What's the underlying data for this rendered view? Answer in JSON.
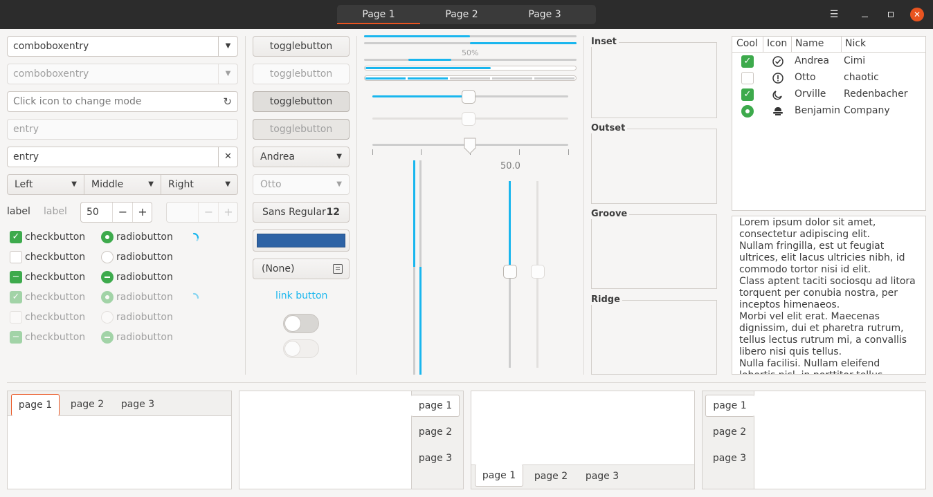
{
  "header": {
    "tabs": [
      "Page 1",
      "Page 2",
      "Page 3"
    ],
    "menu_icon": "hamburger-icon",
    "minimize_icon": "minimize-icon",
    "maximize_icon": "maximize-icon",
    "close_icon": "close-icon"
  },
  "col1": {
    "combo1": "comboboxentry",
    "combo2": "comboboxentry",
    "mode_placeholder": "Click icon to change mode",
    "entry_placeholder": "entry",
    "entry_value": "entry",
    "left": "Left",
    "middle": "Middle",
    "right": "Right",
    "label1": "label",
    "label2": "label",
    "spin_value": "50",
    "minus": "−",
    "plus": "+",
    "check_label": "checkbutton",
    "radio_label": "radiobutton"
  },
  "col2": {
    "toggle": "togglebutton",
    "combo_andrea": "Andrea",
    "combo_otto": "Otto",
    "font_name": "Sans Regular",
    "font_size": "12",
    "color_value": "#2e63a5",
    "file_none": "(None)",
    "link": "link button"
  },
  "col3": {
    "progress_text": "50%",
    "scale_value": "50.0",
    "progress_value": 0.5
  },
  "frames": {
    "inset": "Inset",
    "outset": "Outset",
    "groove": "Groove",
    "ridge": "Ridge"
  },
  "tree": {
    "headers": [
      "Cool",
      "Icon",
      "Name",
      "Nick"
    ],
    "rows": [
      {
        "name": "Andrea",
        "nick": "Cimi",
        "icon": "check-circle-icon"
      },
      {
        "name": "Otto",
        "nick": "chaotic",
        "icon": "exclamation-circle-icon"
      },
      {
        "name": "Orville",
        "nick": "Redenbacher",
        "icon": "moon-icon"
      },
      {
        "name": "Benjamin",
        "nick": "Company",
        "icon": "hat-icon"
      }
    ]
  },
  "textview": {
    "text": "Lorem ipsum dolor sit amet, consectetur adipiscing elit.\nNullam fringilla, est ut feugiat ultrices, elit lacus ultricies nibh, id commodo tortor nisi id elit.\nClass aptent taciti sociosqu ad litora torquent per conubia nostra, per inceptos himenaeos.\nMorbi vel elit erat. Maecenas dignissim, dui et pharetra rutrum, tellus lectus rutrum mi, a convallis libero nisi quis tellus.\nNulla facilisi. Nullam eleifend lobortis nisl, in porttitor tellus malesuada"
  },
  "notebooks": {
    "tabs": [
      "page 1",
      "page 2",
      "page 3"
    ]
  }
}
